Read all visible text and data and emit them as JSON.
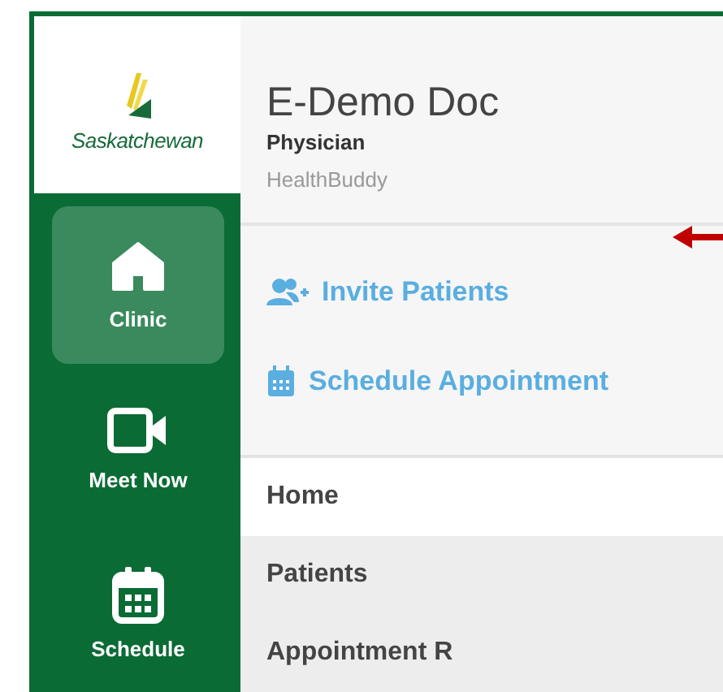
{
  "logo": {
    "text": "Saskatchewan"
  },
  "sidebar": {
    "items": [
      {
        "label": "Clinic",
        "kind": "home",
        "selected": true
      },
      {
        "label": "Meet Now",
        "kind": "video",
        "selected": false
      },
      {
        "label": "Schedule",
        "kind": "calendar",
        "selected": false
      }
    ]
  },
  "profile": {
    "name": "E-Demo Doc",
    "role": "Physician",
    "app": "HealthBuddy"
  },
  "actions": [
    {
      "label": "Invite Patients",
      "kind": "invite"
    },
    {
      "label": "Schedule Appointment",
      "kind": "calendar"
    }
  ],
  "menu": [
    {
      "label": "Home",
      "selected": true
    },
    {
      "label": "Patients",
      "selected": false
    },
    {
      "label": "Appointment R",
      "selected": false
    }
  ]
}
